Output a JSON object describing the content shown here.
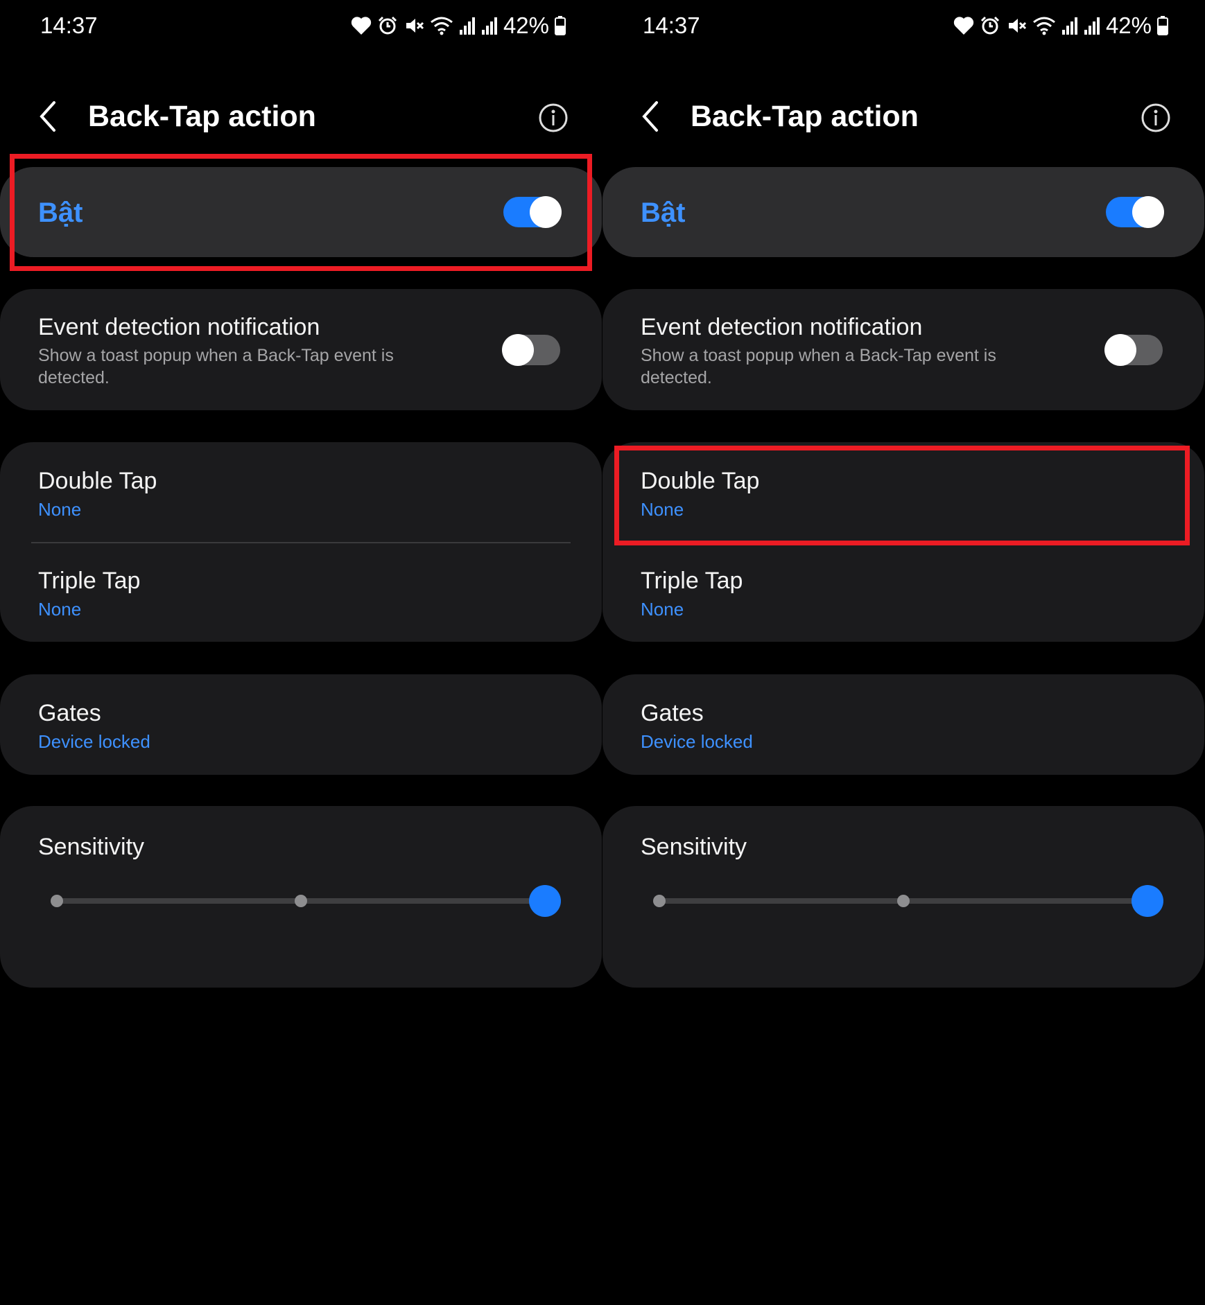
{
  "colors": {
    "accent": "#1a7cff",
    "accent_text": "#3e91ff",
    "highlight": "#ec1c24"
  },
  "panels": [
    {
      "status": {
        "time": "14:37",
        "battery": "42%",
        "icons": [
          "heart-icon",
          "alarm-icon",
          "mute-icon",
          "wifi-icon",
          "signal-icon",
          "signal-icon",
          "battery-icon"
        ]
      },
      "header": {
        "title": "Back-Tap action",
        "back_icon": "back-chevron-icon",
        "info_icon": "info-icon"
      },
      "master": {
        "label": "Bật",
        "enabled": true
      },
      "event_notification": {
        "title": "Event detection notification",
        "description": "Show a toast popup when a Back-Tap event is detected.",
        "enabled": false
      },
      "double_tap": {
        "title": "Double Tap",
        "value": "None"
      },
      "triple_tap": {
        "title": "Triple Tap",
        "value": "None"
      },
      "gates": {
        "title": "Gates",
        "value": "Device locked"
      },
      "sensitivity": {
        "title": "Sensitivity",
        "levels": 3,
        "selected_level": 3
      },
      "highlighted": "master"
    },
    {
      "status": {
        "time": "14:37",
        "battery": "42%",
        "icons": [
          "heart-icon",
          "alarm-icon",
          "mute-icon",
          "wifi-icon",
          "signal-icon",
          "signal-icon",
          "battery-icon"
        ]
      },
      "header": {
        "title": "Back-Tap action",
        "back_icon": "back-chevron-icon",
        "info_icon": "info-icon"
      },
      "master": {
        "label": "Bật",
        "enabled": true
      },
      "event_notification": {
        "title": "Event detection notification",
        "description": "Show a toast popup when a Back-Tap event is detected.",
        "enabled": false
      },
      "double_tap": {
        "title": "Double Tap",
        "value": "None"
      },
      "triple_tap": {
        "title": "Triple Tap",
        "value": "None"
      },
      "gates": {
        "title": "Gates",
        "value": "Device locked"
      },
      "sensitivity": {
        "title": "Sensitivity",
        "levels": 3,
        "selected_level": 3
      },
      "highlighted": "double_tap"
    }
  ]
}
